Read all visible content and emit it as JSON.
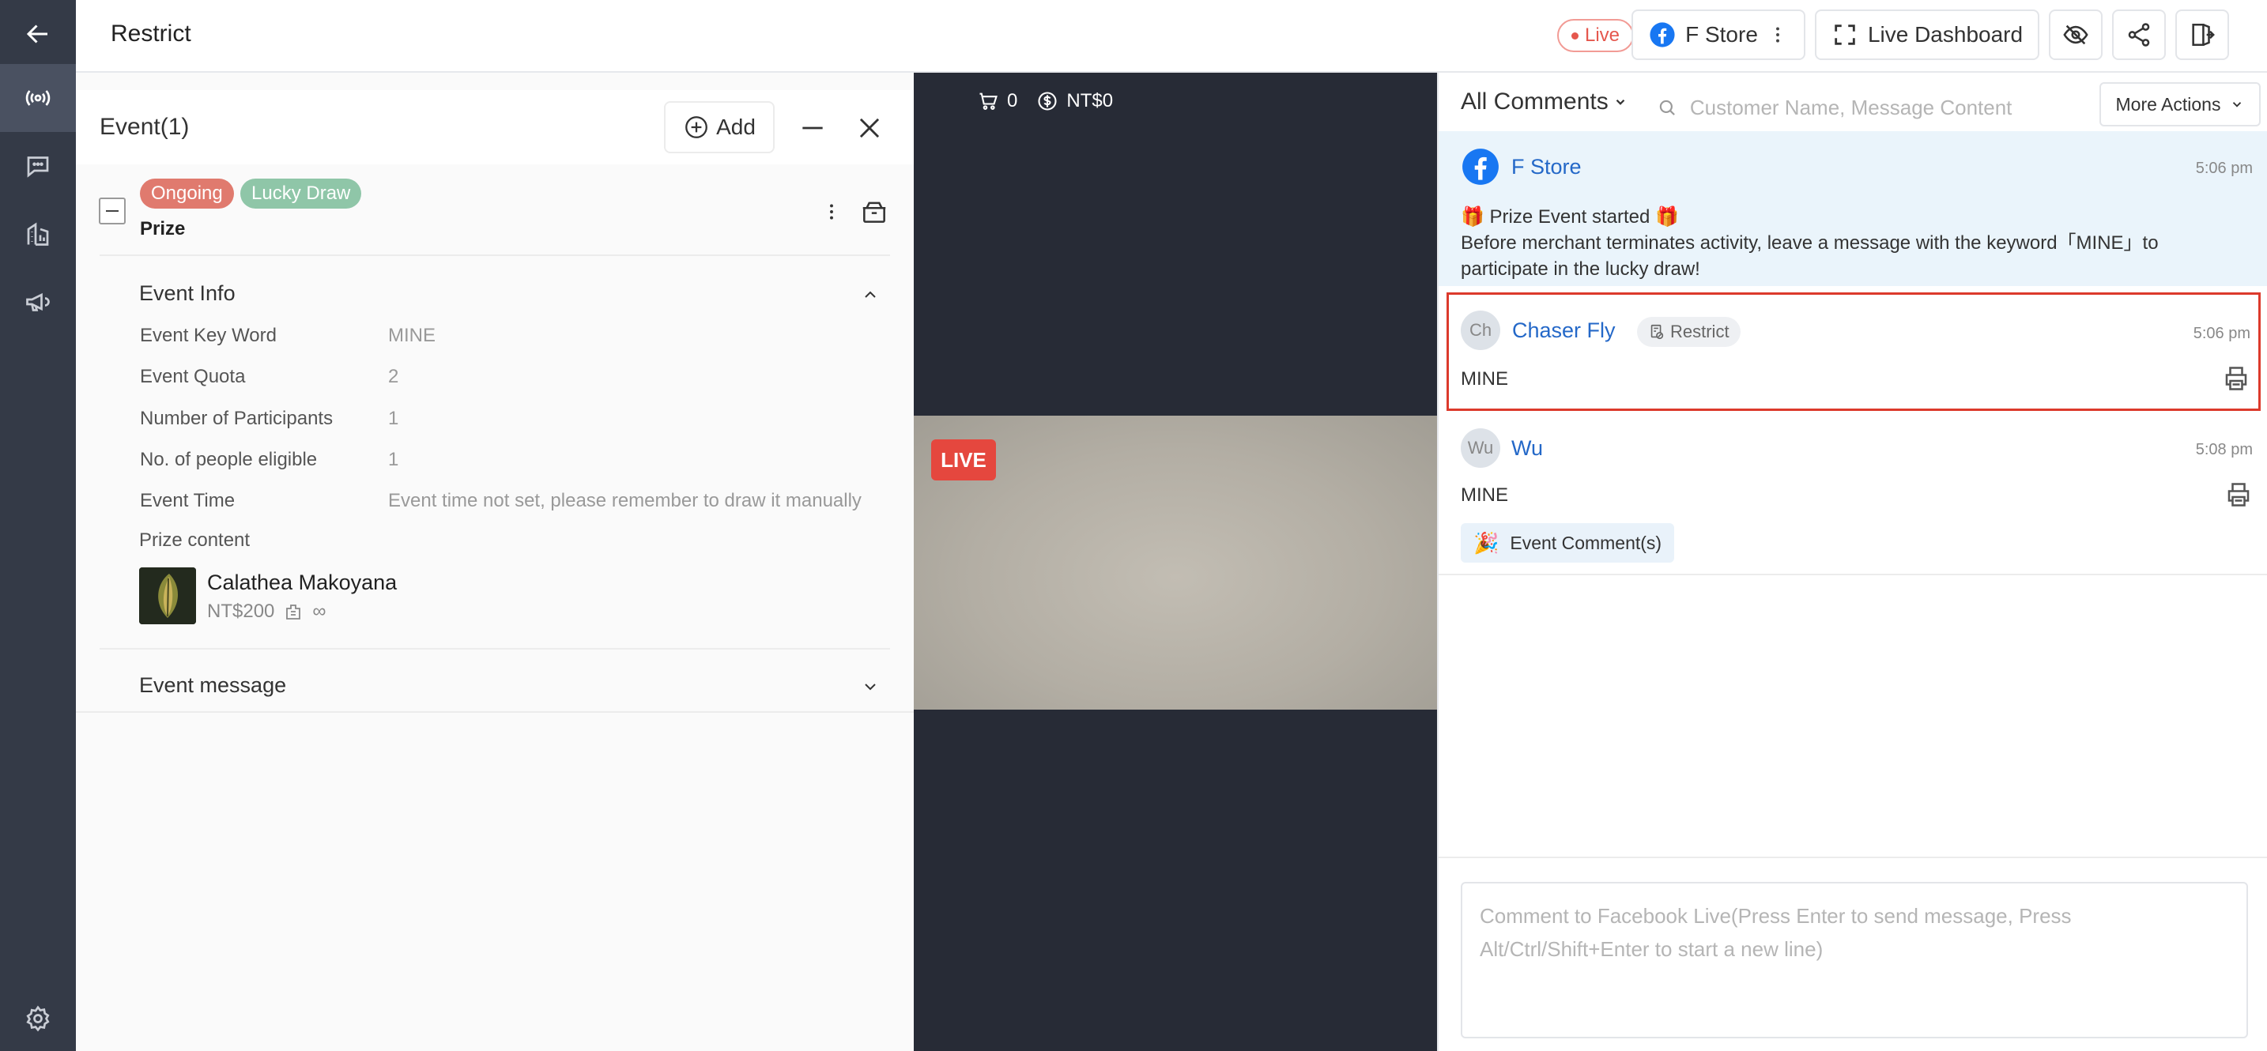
{
  "header": {
    "title": "Restrict",
    "live_label": "Live",
    "store_name": "F Store",
    "dashboard_label": "Live Dashboard"
  },
  "nav": {
    "icons": [
      "back-arrow-icon",
      "live-broadcast-icon",
      "chat-icon",
      "stats-building-icon",
      "megaphone-icon",
      "settings-icon"
    ]
  },
  "event_panel": {
    "title": "Event(1)",
    "add_label": "Add",
    "status_tag": "Ongoing",
    "type_tag": "Lucky Draw",
    "event_name": "Prize",
    "info_title": "Event Info",
    "info": [
      {
        "label": "Event Key Word",
        "value": "MINE"
      },
      {
        "label": "Event Quota",
        "value": "2"
      },
      {
        "label": "Number of Participants",
        "value": "1"
      },
      {
        "label": "No. of people eligible",
        "value": "1"
      },
      {
        "label": "Event Time",
        "value": "Event time not set, please remember to draw it manually"
      }
    ],
    "prize_content_label": "Prize content",
    "prize": {
      "name": "Calathea Makoyana",
      "price": "NT$200",
      "stock": "∞"
    },
    "message_title": "Event message"
  },
  "video": {
    "cart_count": "0",
    "amount": "NT$0",
    "live_badge": "LIVE"
  },
  "comments": {
    "filter_label": "All Comments",
    "search_placeholder": "Customer Name, Message Content",
    "more_actions_label": "More Actions",
    "items": [
      {
        "name": "F Store",
        "time": "5:06 pm",
        "line1": "🎁 Prize Event started 🎁",
        "line2": "Before merchant terminates activity, leave a message with the keyword「MINE」to participate in the lucky draw!"
      },
      {
        "avatar": "Ch",
        "name": "Chaser Fly",
        "tag": "Restrict",
        "time": "5:06 pm",
        "text": "MINE"
      },
      {
        "avatar": "Wu",
        "name": "Wu",
        "time": "5:08 pm",
        "text": "MINE",
        "chip": "Event Comment(s)"
      }
    ],
    "reply_placeholder": "Comment to Facebook Live(Press Enter to send message, Press Alt/Ctrl/Shift+Enter to start a new line)"
  },
  "colors": {
    "nav_bg": "#343a47",
    "ongoing_tag": "#e07a6e",
    "lucky_draw_tag": "#8fc6a8",
    "link_blue": "#2468c8",
    "highlight_border": "#dc3a2c",
    "live_red": "#e5473e"
  }
}
